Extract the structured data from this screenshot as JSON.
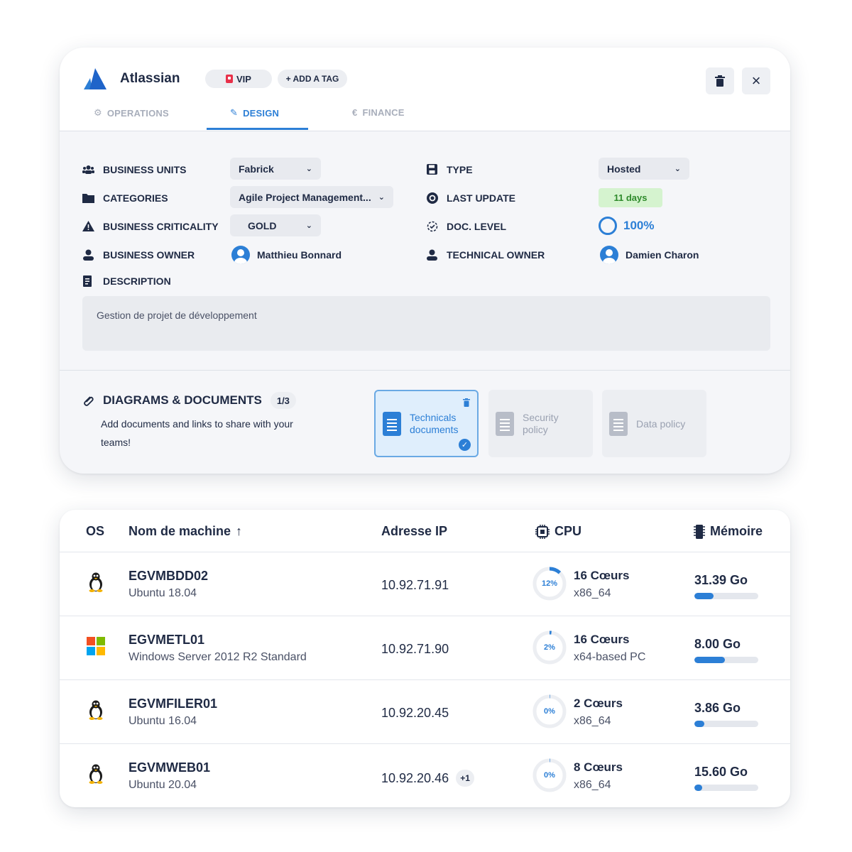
{
  "app": {
    "title": "Atlassian",
    "tags": [
      "VIP",
      "+ ADD A TAG"
    ],
    "tabs": [
      "OPERATIONS",
      "DESIGN",
      "FINANCE"
    ],
    "active_tab": "DESIGN"
  },
  "fields": {
    "business_units": {
      "label": "BUSINESS UNITS",
      "value": "Fabrick"
    },
    "categories": {
      "label": "CATEGORIES",
      "value": "Agile Project Management..."
    },
    "criticality": {
      "label": "BUSINESS CRITICALITY",
      "value": "GOLD"
    },
    "business_owner": {
      "label": "BUSINESS OWNER",
      "value": "Matthieu Bonnard"
    },
    "description": {
      "label": "DESCRIPTION",
      "value": "Gestion de projet de développement"
    },
    "type": {
      "label": "TYPE",
      "value": "Hosted"
    },
    "last_update": {
      "label": "LAST UPDATE",
      "value": "11 days"
    },
    "doc_level": {
      "label": "DOC. LEVEL",
      "value": "100%"
    },
    "technical_owner": {
      "label": "TECHNICAL OWNER",
      "value": "Damien Charon"
    }
  },
  "diagrams": {
    "title": "DIAGRAMS & DOCUMENTS",
    "count": "1/3",
    "subtitle": "Add documents and links to share with your teams!",
    "cards": [
      {
        "label": "Technicals documents",
        "selected": true
      },
      {
        "label": "Security policy",
        "selected": false
      },
      {
        "label": "Data policy",
        "selected": false
      }
    ]
  },
  "table": {
    "headers": {
      "os": "OS",
      "name": "Nom de machine",
      "ip": "Adresse IP",
      "cpu": "CPU",
      "mem": "Mémoire"
    },
    "rows": [
      {
        "os_icon": "linux-icon",
        "name": "EGVMBDD02",
        "os": "Ubuntu 18.04",
        "ip": "10.92.71.91",
        "ip_extra": "",
        "cpu_pct": "12%",
        "cpu_usage": 0.12,
        "cores": "16 Cœurs",
        "arch": "x86_64",
        "mem": "31.39 Go",
        "mem_fill": 0.3
      },
      {
        "os_icon": "windows-icon",
        "name": "EGVMETL01",
        "os": "Windows Server 2012 R2 Standard",
        "ip": "10.92.71.90",
        "ip_extra": "",
        "cpu_pct": "2%",
        "cpu_usage": 0.02,
        "cores": "16 Cœurs",
        "arch": "x64-based PC",
        "mem": "8.00 Go",
        "mem_fill": 0.48
      },
      {
        "os_icon": "linux-icon",
        "name": "EGVMFILER01",
        "os": "Ubuntu 16.04",
        "ip": "10.92.20.45",
        "ip_extra": "",
        "cpu_pct": "0%",
        "cpu_usage": 0.0,
        "cores": "2 Cœurs",
        "arch": "x86_64",
        "mem": "3.86 Go",
        "mem_fill": 0.15
      },
      {
        "os_icon": "linux-icon",
        "name": "EGVMWEB01",
        "os": "Ubuntu 20.04",
        "ip": "10.92.20.46",
        "ip_extra": "+1",
        "cpu_pct": "0%",
        "cpu_usage": 0.0,
        "cores": "8 Cœurs",
        "arch": "x86_64",
        "mem": "15.60 Go",
        "mem_fill": 0.12
      }
    ]
  },
  "colors": {
    "accent": "#2c7fd6",
    "text": "#1f2a44",
    "success": "#2e8a2b"
  }
}
